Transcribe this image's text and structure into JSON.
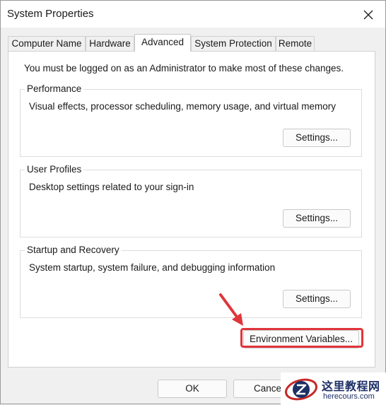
{
  "window": {
    "title": "System Properties"
  },
  "tabs": [
    {
      "label": "Computer Name",
      "active": false
    },
    {
      "label": "Hardware",
      "active": false
    },
    {
      "label": "Advanced",
      "active": true
    },
    {
      "label": "System Protection",
      "active": false
    },
    {
      "label": "Remote",
      "active": false
    }
  ],
  "panel": {
    "admin_note": "You must be logged on as an Administrator to make most of these changes.",
    "groups": [
      {
        "title": "Performance",
        "description": "Visual effects, processor scheduling, memory usage, and virtual memory",
        "button": "Settings..."
      },
      {
        "title": "User Profiles",
        "description": "Desktop settings related to your sign-in",
        "button": "Settings..."
      },
      {
        "title": "Startup and Recovery",
        "description": "System startup, system failure, and debugging information",
        "button": "Settings..."
      }
    ],
    "env_button": "Environment Variables..."
  },
  "footer": {
    "ok": "OK",
    "cancel": "Cancel"
  },
  "watermark": {
    "name": "这里教程网",
    "url": "herecours.com"
  },
  "colors": {
    "highlight": "#e0353a",
    "watermark_text": "#1c2f66"
  },
  "icons": {
    "close": "close-icon",
    "arrow": "red-arrow-annotation-icon",
    "logo": "watermark-logo-icon"
  }
}
